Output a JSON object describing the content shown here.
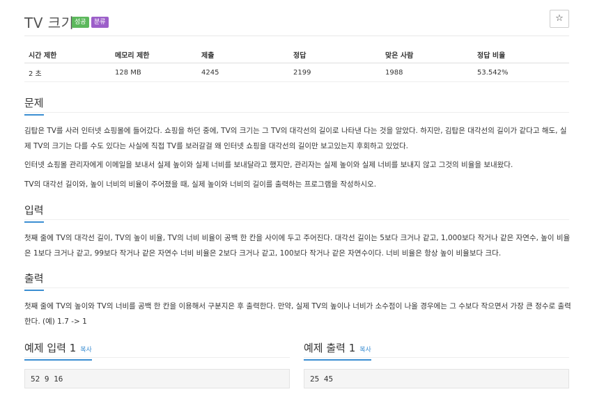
{
  "problem": {
    "title": "TV 크기",
    "badges": {
      "success": "성공",
      "category": "분류"
    },
    "star_icon": "☆"
  },
  "stats": {
    "headers": [
      "시간 제한",
      "메모리 제한",
      "제출",
      "정답",
      "맞은 사람",
      "정답 비율"
    ],
    "values": [
      "2 초",
      "128 MB",
      "4245",
      "2199",
      "1988",
      "53.542%"
    ]
  },
  "sections": {
    "problem_heading": "문제",
    "problem_paragraphs": [
      "김탑은 TV를 사러 인터넷 쇼핑몰에 들어갔다. 쇼핑을 하던 중에, TV의 크기는 그 TV의 대각선의 길이로 나타낸 다는 것을 알았다. 하지만, 김탑은 대각선의 길이가 같다고 해도, 실제 TV의 크기는 다를 수도 있다는 사실에 직접 TV를 보러갈걸 왜 인터넷 쇼핑을 대각선의 길이만 보고있는지 후회하고 있었다.",
      "인터넷 쇼핑몰 관리자에게 이메일을 보내서 실제 높이와 실제 너비를 보내달라고 했지만, 관리자는 실제 높이와 실제 너비를 보내지 않고 그것의 비율을 보내왔다.",
      "TV의 대각선 길이와, 높이 너비의 비율이 주어졌을 때, 실제 높이와 너비의 길이를 출력하는 프로그램을 작성하시오."
    ],
    "input_heading": "입력",
    "input_text": "첫째 줄에 TV의 대각선 길이, TV의 높이 비율, TV의 너비 비율이 공백 한 칸을 사이에 두고 주어진다. 대각선 길이는 5보다 크거나 같고, 1,000보다 작거나 같은 자연수, 높이 비율은 1보다 크거나 같고, 99보다 작거나 같은 자연수 너비 비율은 2보다 크거나 같고, 100보다 작거나 같은 자연수이다. 너비 비율은 항상 높이 비율보다 크다.",
    "output_heading": "출력",
    "output_text": "첫째 줄에 TV의 높이와 TV의 너비를 공백 한 칸을 이용해서 구분지은 후 출력한다. 만약, 실제 TV의 높이나 너비가 소수점이 나올 경우에는 그 수보다 작으면서 가장 큰 정수로 출력한다. (예) 1.7 -> 1"
  },
  "samples": {
    "input_title": "예제 입력 1",
    "output_title": "예제 출력 1",
    "copy_label": "복사",
    "input_value": "52 9 16",
    "output_value": "25 45"
  }
}
